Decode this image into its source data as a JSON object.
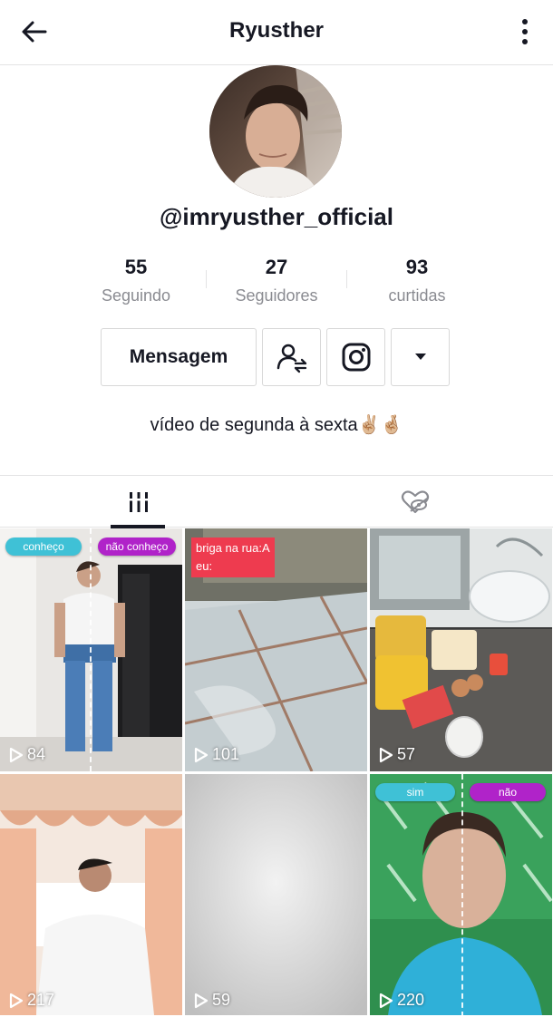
{
  "header": {
    "title": "Ryusther",
    "back_icon": "arrow-left-icon",
    "more_icon": "vertical-dots-icon"
  },
  "profile": {
    "handle": "@imryusther_official",
    "stats": [
      {
        "value": "55",
        "label": "Seguindo"
      },
      {
        "value": "27",
        "label": "Seguidores"
      },
      {
        "value": "93",
        "label": "curtidas"
      }
    ],
    "message_button": "Mensagem",
    "bio": "vídeo de segunda à sexta✌🏼🤞🏼"
  },
  "tabs": [
    {
      "name": "videos",
      "icon": "grid-icon",
      "active": true
    },
    {
      "name": "liked",
      "icon": "heart-hidden-icon",
      "active": false
    }
  ],
  "videos": [
    {
      "views": "84",
      "overlays": [
        "conheço",
        "não conheço"
      ]
    },
    {
      "views": "101",
      "caption": [
        "briga na rua:A",
        "eu:"
      ]
    },
    {
      "views": "57"
    },
    {
      "views": "217"
    },
    {
      "views": "59"
    },
    {
      "views": "220",
      "overlays": [
        "sim",
        "não"
      ]
    }
  ],
  "colors": {
    "text": "#161823",
    "muted": "#8a8b91",
    "border": "#e3e3e4",
    "pill_blue": "#3fc1d6",
    "pill_purple": "#b023c9",
    "caption_red": "#ee3b4f"
  }
}
